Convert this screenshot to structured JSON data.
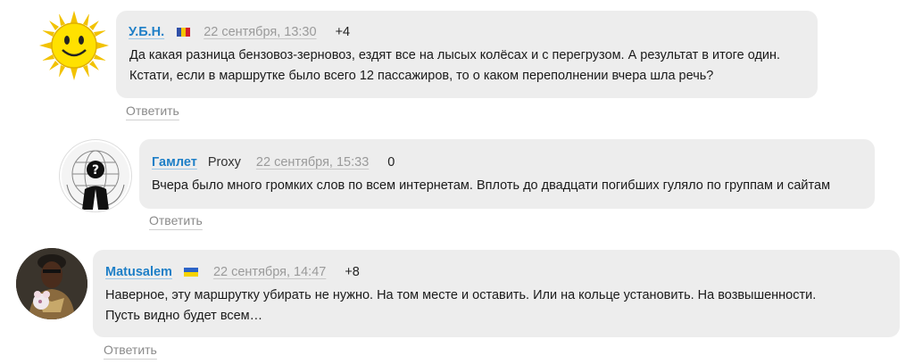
{
  "comments": [
    {
      "author": "У.Б.Н.",
      "flag": [
        "#2f4fa8",
        "#f2c400",
        "#d41e2c"
      ],
      "flag_icon": "moldova-flag-icon",
      "avatar_icon": "sun-smiley-avatar",
      "date": "22 сентября, 13:30",
      "score": "+4",
      "lines": [
        "Да какая разница бензовоз-зерновоз, ездят все на лысых колёсах и с перегрузом. А результат в итоге один.",
        "Кстати, если в маршрутке было всего 12 пассажиров, то о каком переполнении вчера шла речь?"
      ],
      "reply": "Ответить"
    },
    {
      "author": "Гамлет",
      "proxy": "Proxy",
      "avatar_icon": "anonymous-mask-avatar",
      "date": "22 сентября, 15:33",
      "score": "0",
      "lines": [
        "Вчера было много громких слов по всем интернетам. Вплоть до двадцати погибших гуляло по группам и сайтам"
      ],
      "reply": "Ответить"
    },
    {
      "author": "Matusalem",
      "flag": [
        "#2d64c8",
        "#f5d300"
      ],
      "flag_icon": "ukraine-flag-icon",
      "avatar_icon": "man-with-toy-avatar",
      "date": "22 сентября, 14:47",
      "score": "+8",
      "lines": [
        "Наверное, эту маршрутку убирать не нужно. На том месте и оставить. Или на кольце установить. На возвышенности.",
        "Пусть видно будет всем…"
      ],
      "reply": "Ответить"
    }
  ],
  "colors": {
    "bubble": "#ededed",
    "author": "#1e7fc7",
    "date": "#9a9a9a",
    "reply": "#8a8a8a"
  }
}
